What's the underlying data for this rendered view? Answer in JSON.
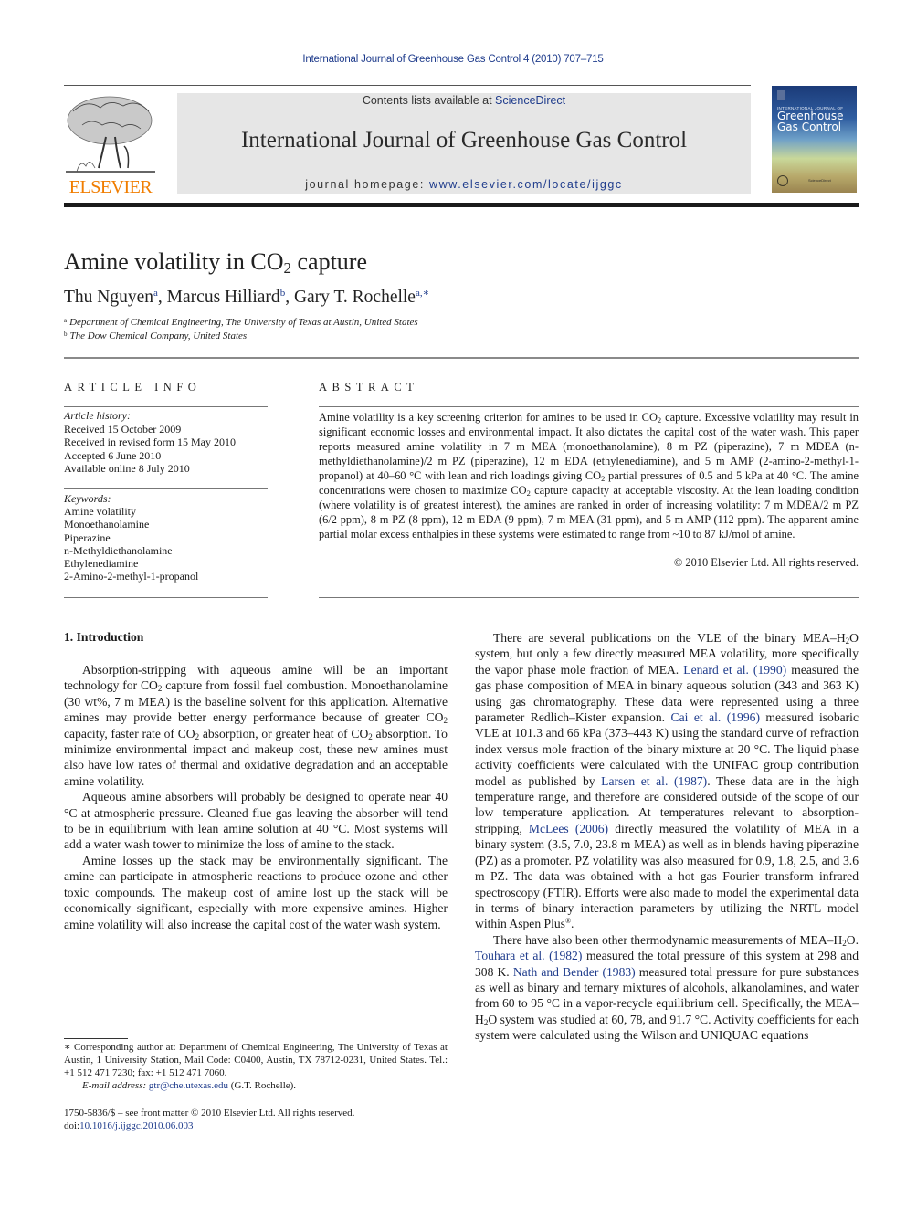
{
  "running_header": "International Journal of Greenhouse Gas Control 4 (2010) 707–715",
  "masthead": {
    "publisher_logo_text": "ELSEVIER",
    "contents_prefix": "Contents lists available at ",
    "contents_link": "ScienceDirect",
    "journal_title": "International Journal of Greenhouse Gas Control",
    "homepage_prefix": "journal homepage: ",
    "homepage_url": "www.elsevier.com/locate/ijggc",
    "cover": {
      "subtitle": "INTERNATIONAL JOURNAL OF",
      "title_line1": "Greenhouse",
      "title_line2": "Gas Control",
      "publisher_mark": "ScienceDirect"
    },
    "colors": {
      "elsevier_orange": "#f07d00",
      "link_blue": "#1f3c8c",
      "masthead_gray": "#e6e6e6"
    }
  },
  "article": {
    "title_pre": "Amine volatility in CO",
    "title_sub": "2",
    "title_post": " capture",
    "authors": [
      {
        "name": "Thu Nguyen",
        "affil": "a"
      },
      {
        "name": "Marcus Hilliard",
        "affil": "b"
      },
      {
        "name": "Gary T. Rochelle",
        "affil": "a,∗"
      }
    ],
    "affiliations": [
      {
        "mark": "a",
        "text": "Department of Chemical Engineering, The University of Texas at Austin, United States"
      },
      {
        "mark": "b",
        "text": "The Dow Chemical Company, United States"
      }
    ]
  },
  "article_info": {
    "heading": "ARTICLE INFO",
    "history_label": "Article history:",
    "history": [
      "Received 15 October 2009",
      "Received in revised form 15 May 2010",
      "Accepted 6 June 2010",
      "Available online 8 July 2010"
    ],
    "keywords_label": "Keywords:",
    "keywords": [
      "Amine volatility",
      "Monoethanolamine",
      "Piperazine",
      "n-Methyldiethanolamine",
      "Ethylenediamine",
      "2-Amino-2-methyl-1-propanol"
    ]
  },
  "abstract": {
    "heading": "ABSTRACT",
    "parts": [
      "Amine volatility is a key screening criterion for amines to be used in CO",
      "2",
      " capture. Excessive volatility may result in significant economic losses and environmental impact. It also dictates the capital cost of the water wash. This paper reports measured amine volatility in 7 m MEA (monoethanolamine), 8 m PZ (piperazine), 7 m MDEA (n-methyldiethanolamine)/2 m PZ (piperazine), 12 m EDA (ethylenediamine), and 5 m AMP (2-amino-2-methyl-1-propanol) at 40–60 °C with lean and rich loadings giving CO",
      "2",
      " partial pressures of 0.5 and 5 kPa at 40 °C. The amine concentrations were chosen to maximize CO",
      "2",
      " capture capacity at acceptable viscosity. At the lean loading condition (where volatility is of greatest interest), the amines are ranked in order of increasing volatility: 7 m MDEA/2 m PZ (6/2 ppm), 8 m PZ (8 ppm), 12 m EDA (9 ppm), 7 m MEA (31 ppm), and 5 m AMP (112 ppm). The apparent amine partial molar excess enthalpies in these systems were estimated to range from ~10 to 87 kJ/mol of amine."
    ],
    "copyright": "© 2010 Elsevier Ltd. All rights reserved."
  },
  "body": {
    "section_heading": "1.  Introduction",
    "left_paragraphs": {
      "p1": [
        "Absorption-stripping with aqueous amine will be an important technology for CO",
        "2",
        " capture from fossil fuel combustion. Monoethanolamine (30 wt%, 7 m MEA) is the baseline solvent for this application. Alternative amines may provide better energy performance because of greater CO",
        "2",
        " capacity, faster rate of CO",
        "2",
        " absorption, or greater heat of CO",
        "2",
        " absorption. To minimize environmental impact and makeup cost, these new amines must also have low rates of thermal and oxidative degradation and an acceptable amine volatility."
      ],
      "p2": "Aqueous amine absorbers will probably be designed to operate near 40 °C at atmospheric pressure. Cleaned flue gas leaving the absorber will tend to be in equilibrium with lean amine solution at 40 °C. Most systems will add a water wash tower to minimize the loss of amine to the stack.",
      "p3": "Amine losses up the stack may be environmentally significant. The amine can participate in atmospheric reactions to produce ozone and other toxic compounds. The makeup cost of amine lost up the stack will be economically significant, especially with more expensive amines. Higher amine volatility will also increase the capital cost of the water wash system."
    },
    "right_paragraphs": {
      "p1": {
        "t1": "There are several publications on the VLE of the binary MEA–H",
        "s1": "2",
        "t2": "O system, but only a few directly measured MEA volatility, more specifically the vapor phase mole fraction of MEA. ",
        "ref1": "Lenard et al. (1990)",
        "t3": " measured the gas phase composition of MEA in binary aqueous solution (343 and 363 K) using gas chromatography. These data were represented using a three parameter Redlich–Kister expansion. ",
        "ref2": "Cai et al. (1996)",
        "t4": " measured isobaric VLE at 101.3 and 66 kPa (373–443 K) using the standard curve of refraction index versus mole fraction of the binary mixture at 20 °C. The liquid phase activity coefficients were calculated with the UNIFAC group contribution model as published by ",
        "ref3": "Larsen et al. (1987)",
        "t5": ". These data are in the high temperature range, and therefore are considered outside of the scope of our low temperature application. At temperatures relevant to absorption-stripping, ",
        "ref4": "McLees (2006)",
        "t6": " directly measured the volatility of MEA in a binary system (3.5, 7.0, 23.8 m MEA) as well as in blends having piperazine (PZ) as a promoter. PZ volatility was also measured for 0.9, 1.8, 2.5, and 3.6 m PZ. The data was obtained with a hot gas Fourier transform infrared spectroscopy (FTIR). Efforts were also made to model the experimental data in terms of binary interaction parameters by utilizing the NRTL model within Aspen Plus",
        "reg": "®",
        "t7": "."
      },
      "p2": {
        "t1": "There have also been other thermodynamic measurements of MEA–H",
        "s1": "2",
        "t2": "O. ",
        "ref1": "Touhara et al. (1982)",
        "t3": " measured the total pressure of this system at 298 and 308 K. ",
        "ref2": "Nath and Bender (1983)",
        "t4": " measured total pressure for pure substances as well as binary and ternary mixtures of alcohols, alkanolamines, and water from 60 to 95 °C in a vapor-recycle equilibrium cell. Specifically, the MEA–H",
        "s2": "2",
        "t5": "O system was studied at 60, 78, and 91.7 °C. Activity coefficients for each system were calculated using the Wilson and UNIQUAC equations"
      }
    }
  },
  "footnote": {
    "corresponding": "∗  Corresponding author at: Department of Chemical Engineering, The University of Texas at Austin, 1 University Station, Mail Code: C0400, Austin, TX 78712-0231, United States. Tel.: +1 512 471 7230; fax: +1 512 471 7060.",
    "email_label": "E-mail address: ",
    "email": "gtr@che.utexas.edu",
    "email_suffix": " (G.T. Rochelle)."
  },
  "front_matter": {
    "issn_line": "1750-5836/$ – see front matter © 2010 Elsevier Ltd. All rights reserved.",
    "doi_prefix": "doi:",
    "doi": "10.1016/j.ijggc.2010.06.003"
  }
}
